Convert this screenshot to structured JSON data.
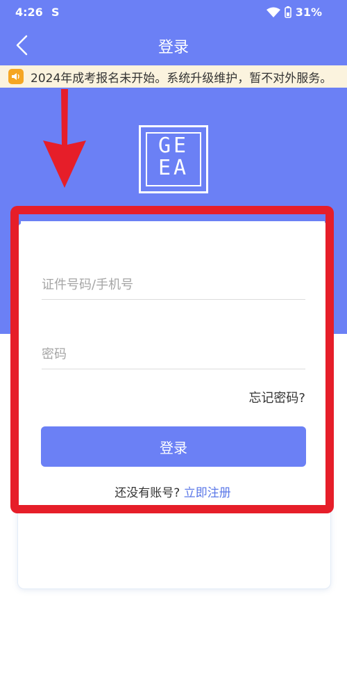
{
  "status_bar": {
    "time": "4:26",
    "notification_icon": "S",
    "battery": "31%",
    "wifi_icon": "wifi-icon",
    "battery_icon": "battery-icon"
  },
  "navbar": {
    "title": "登录",
    "back_icon": "chevron-left-icon"
  },
  "notice": {
    "icon": "speaker-icon",
    "text": "2024年成考报名未开始。系统升级维护，暂不对外服务。"
  },
  "logo": {
    "line1": "GE",
    "line2": "EA"
  },
  "form": {
    "username_placeholder": "证件号码/手机号",
    "username_value": "",
    "password_placeholder": "密码",
    "password_value": "",
    "forgot_label": "忘记密码?",
    "login_label": "登录",
    "no_account_text": "还没有账号?",
    "register_label": "立即注册"
  },
  "colors": {
    "primary": "#6b80f5",
    "annotation_red": "#e61e29",
    "notice_bg": "#fbf3de",
    "notice_icon": "#f5a623",
    "link": "#5b78e8"
  }
}
